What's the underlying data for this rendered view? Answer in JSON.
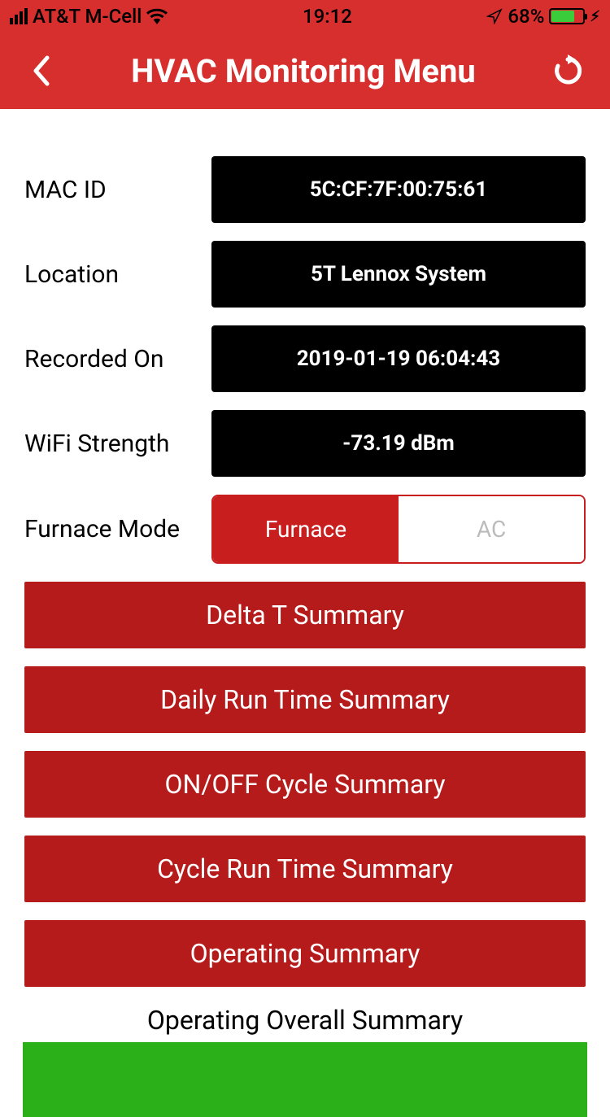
{
  "status_bar": {
    "carrier": "AT&T M-Cell",
    "time": "19:12",
    "battery_pct": "68%"
  },
  "nav": {
    "title": "HVAC Monitoring Menu"
  },
  "info": {
    "mac_id_label": "MAC ID",
    "mac_id_value": "5C:CF:7F:00:75:61",
    "location_label": "Location",
    "location_value": "5T Lennox System",
    "recorded_label": "Recorded On",
    "recorded_value": "2019-01-19 06:04:43",
    "wifi_label": "WiFi Strength",
    "wifi_value": "-73.19 dBm"
  },
  "mode": {
    "label": "Furnace Mode",
    "option_furnace": "Furnace",
    "option_ac": "AC"
  },
  "menu": {
    "delta_t": "Delta T Summary",
    "daily_run": "Daily Run Time Summary",
    "on_off": "ON/OFF Cycle Summary",
    "cycle_run": "Cycle Run Time Summary",
    "operating": "Operating Summary"
  },
  "overall": {
    "title": "Operating Overall Summary"
  }
}
